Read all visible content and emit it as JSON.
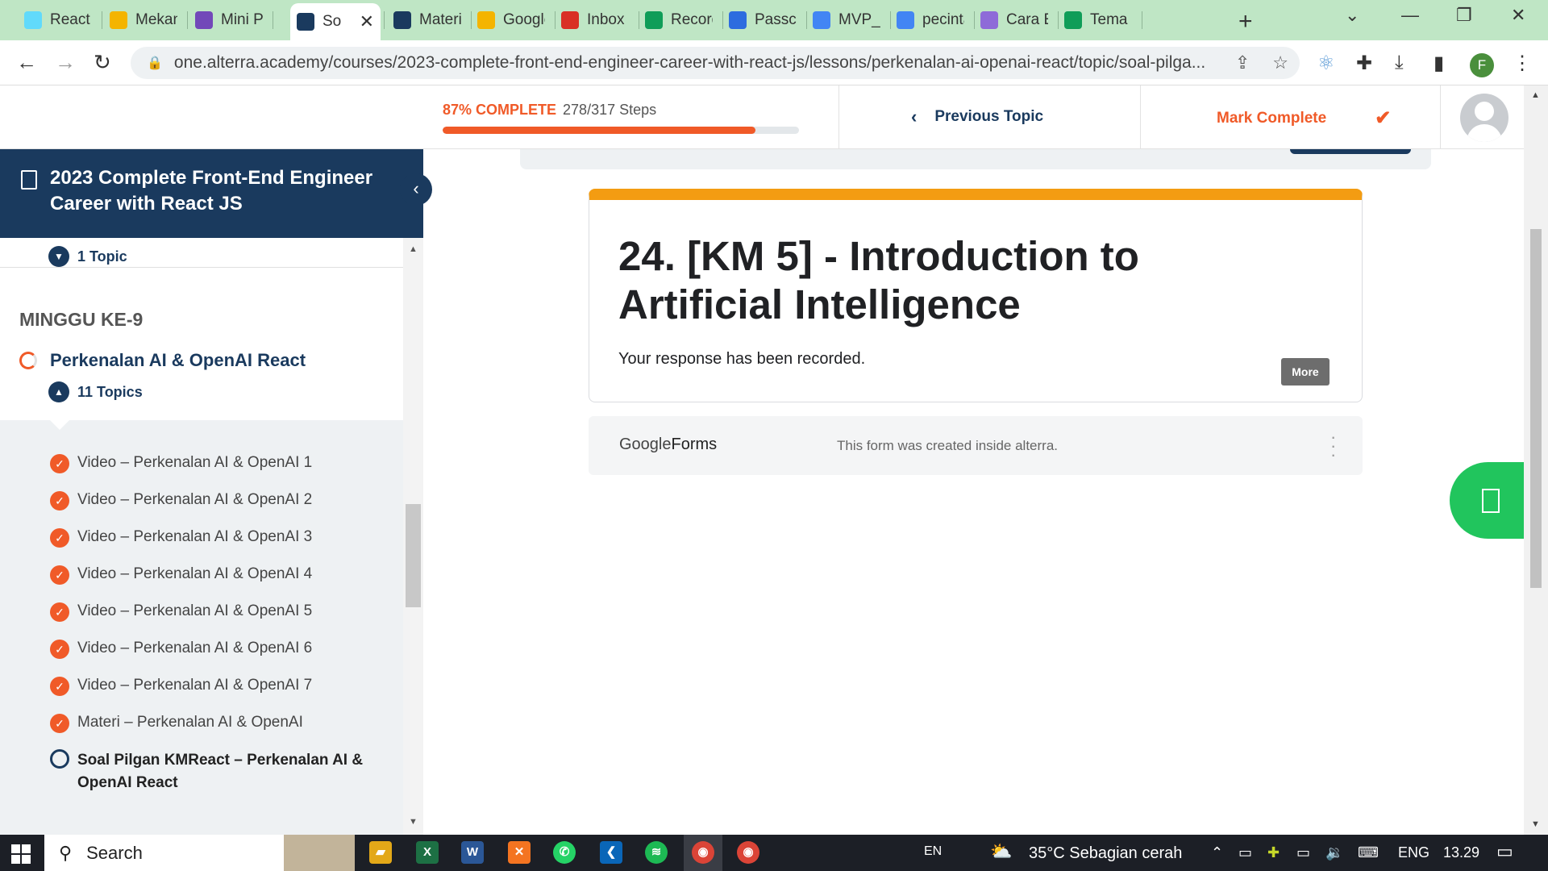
{
  "browser": {
    "tabs": [
      {
        "title": "React",
        "favicon": "react-icon",
        "color": "#61dafb"
      },
      {
        "title": "Mekan",
        "favicon": "slides-icon",
        "color": "#f4b400"
      },
      {
        "title": "Mini Pr",
        "favicon": "forms-icon",
        "color": "#7248b9"
      },
      {
        "title": "So",
        "favicon": "alterra-icon",
        "color": "#1a3a5e",
        "active": true
      },
      {
        "title": "Materi",
        "favicon": "alterra-icon",
        "color": "#1a3a5e"
      },
      {
        "title": "Google",
        "favicon": "slides-icon",
        "color": "#f4b400"
      },
      {
        "title": "Inbox (",
        "favicon": "gmail-icon",
        "color": "#d93025"
      },
      {
        "title": "Record",
        "favicon": "sheets-icon",
        "color": "#0f9d58"
      },
      {
        "title": "Passco",
        "favicon": "z-icon",
        "color": "#2d6cdf"
      },
      {
        "title": "MVP_F",
        "favicon": "docs-icon",
        "color": "#4285f4"
      },
      {
        "title": "pecinta",
        "favicon": "google-icon",
        "color": "#4285f4"
      },
      {
        "title": "Cara E",
        "favicon": "app-icon",
        "color": "#8e6bd8"
      },
      {
        "title": "Tema N",
        "favicon": "sheets-icon",
        "color": "#0f9d58"
      }
    ],
    "url": "one.alterra.academy/courses/2023-complete-front-end-engineer-career-with-react-js/lessons/perkenalan-ai-openai-react/topic/soal-pilga...",
    "profile_initial": "F"
  },
  "header": {
    "progress_pct_label": "87% COMPLETE",
    "progress_steps": "278/317 Steps",
    "progress_fraction": 0.877,
    "previous_topic": "Previous Topic",
    "mark_complete": "Mark Complete"
  },
  "sidebar": {
    "course_title": "2023 Complete Front-End Engineer Career with React JS",
    "prev_topic_count": "1 Topic",
    "week_label": "MINGGU KE-9",
    "lesson_title": "Perkenalan AI & OpenAI React",
    "topics_count": "11 Topics",
    "topics": [
      {
        "label": "Video – Perkenalan AI & OpenAI 1",
        "done": true
      },
      {
        "label": "Video – Perkenalan AI & OpenAI 2",
        "done": true
      },
      {
        "label": "Video – Perkenalan AI & OpenAI 3",
        "done": true
      },
      {
        "label": "Video – Perkenalan AI & OpenAI 4",
        "done": true
      },
      {
        "label": "Video – Perkenalan AI & OpenAI 5",
        "done": true
      },
      {
        "label": "Video – Perkenalan AI & OpenAI 6",
        "done": true
      },
      {
        "label": "Video – Perkenalan AI & OpenAI 7",
        "done": true
      },
      {
        "label": "Materi – Perkenalan AI & OpenAI",
        "done": true
      },
      {
        "label": "Soal Pilgan KMReact – Perkenalan AI & OpenAI React",
        "done": false
      }
    ]
  },
  "form": {
    "title": "24. [KM 5] - Introduction to Artificial Intelligence",
    "message": "Your response has been recorded.",
    "more_label": "More",
    "footer_logo_a": "Google",
    "footer_logo_b": "Forms",
    "footer_note": "This form was created inside alterra.",
    "accent_color": "#f39c12"
  },
  "taskbar": {
    "search_placeholder": "Search",
    "lang_short": "EN",
    "weather": "35°C  Sebagian cerah",
    "lang": "ENG",
    "time": "13.29"
  }
}
